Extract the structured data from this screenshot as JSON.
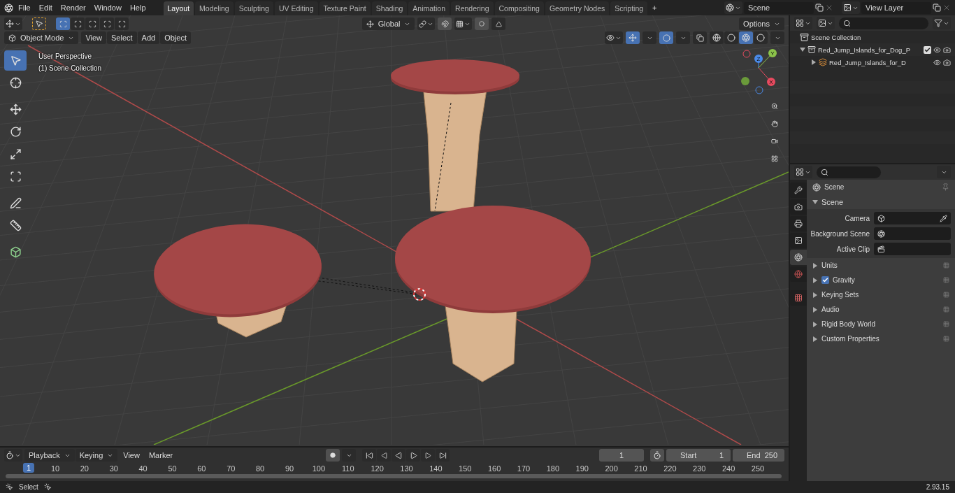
{
  "menu": [
    "File",
    "Edit",
    "Render",
    "Window",
    "Help"
  ],
  "workspaces": [
    {
      "label": "Layout",
      "selected": true
    },
    {
      "label": "Modeling",
      "selected": false
    },
    {
      "label": "Sculpting",
      "selected": false
    },
    {
      "label": "UV Editing",
      "selected": false
    },
    {
      "label": "Texture Paint",
      "selected": false
    },
    {
      "label": "Shading",
      "selected": false
    },
    {
      "label": "Animation",
      "selected": false
    },
    {
      "label": "Rendering",
      "selected": false
    },
    {
      "label": "Compositing",
      "selected": false
    },
    {
      "label": "Geometry Nodes",
      "selected": false
    },
    {
      "label": "Scripting",
      "selected": false
    }
  ],
  "add_workspace": "+",
  "scene_field": "Scene",
  "view_layer_field": "View Layer",
  "viewport": {
    "select_modes": [
      {
        "selected": true
      },
      {
        "selected": false
      },
      {
        "selected": false
      },
      {
        "selected": false
      },
      {
        "selected": false
      }
    ],
    "orientation": "Global",
    "options": "Options",
    "mode": "Object Mode",
    "menus": [
      "View",
      "Select",
      "Add",
      "Object"
    ],
    "overlay_lines": [
      "User Perspective",
      "(1) Scene Collection"
    ],
    "shading": [
      {
        "selected": false
      },
      {
        "selected": false
      },
      {
        "selected": true
      },
      {
        "selected": false
      }
    ],
    "tools": [
      {
        "kind": "select",
        "selected": true
      },
      {
        "kind": "cursor",
        "selected": false
      },
      {
        "kind": "move",
        "selected": false
      },
      {
        "kind": "rotate",
        "selected": false
      },
      {
        "kind": "scale",
        "selected": false
      },
      {
        "kind": "transform",
        "selected": false
      },
      {
        "kind": "annotate",
        "selected": false
      },
      {
        "kind": "measure",
        "selected": false
      },
      {
        "kind": "add",
        "selected": false
      }
    ],
    "gizmo_axes": [
      "Z",
      "Y",
      "X"
    ]
  },
  "outliner": {
    "root": "Scene Collection",
    "tree": [
      {
        "label": "Red_Jump_Islands_for_Dog_P",
        "kind": "collection",
        "expanded": true,
        "checked": true,
        "children": [
          {
            "label": "Red_Jump_Islands_for_D",
            "kind": "empty",
            "expanded": false
          }
        ]
      }
    ]
  },
  "properties": {
    "tabs": [
      {
        "kind": "tool",
        "selected": false
      },
      {
        "kind": "render",
        "selected": false
      },
      {
        "kind": "output",
        "selected": false
      },
      {
        "kind": "view_layer",
        "selected": false
      },
      {
        "kind": "scene",
        "selected": true
      },
      {
        "kind": "world",
        "selected": false
      },
      {
        "kind": "texture",
        "selected": false
      }
    ],
    "context": "Scene",
    "section": "Scene",
    "section_expanded": true,
    "fields": [
      {
        "label": "Camera",
        "kind": "object"
      },
      {
        "label": "Background Scene",
        "kind": "scene"
      },
      {
        "label": "Active Clip",
        "kind": "clip"
      }
    ],
    "panels": [
      {
        "label": "Units",
        "kind": "plain"
      },
      {
        "label": "Gravity",
        "kind": "toggle",
        "checked": true
      },
      {
        "label": "Keying Sets",
        "kind": "plain"
      },
      {
        "label": "Audio",
        "kind": "plain"
      },
      {
        "label": "Rigid Body World",
        "kind": "plain"
      },
      {
        "label": "Custom Properties",
        "kind": "plain"
      }
    ]
  },
  "timeline": {
    "menus": [
      "Playback",
      "Keying"
    ],
    "plain_menus": [
      "View",
      "Marker"
    ],
    "current_frame": "1",
    "start_label": "Start",
    "start": "1",
    "end_label": "End",
    "end": "250",
    "playhead": "1",
    "ticks": [
      "10",
      "20",
      "30",
      "40",
      "50",
      "60",
      "70",
      "80",
      "90",
      "100",
      "110",
      "120",
      "130",
      "140",
      "150",
      "160",
      "170",
      "180",
      "190",
      "200",
      "210",
      "220",
      "230",
      "240",
      "250"
    ]
  },
  "status": {
    "hint": "Select",
    "version": "2.93.15"
  }
}
